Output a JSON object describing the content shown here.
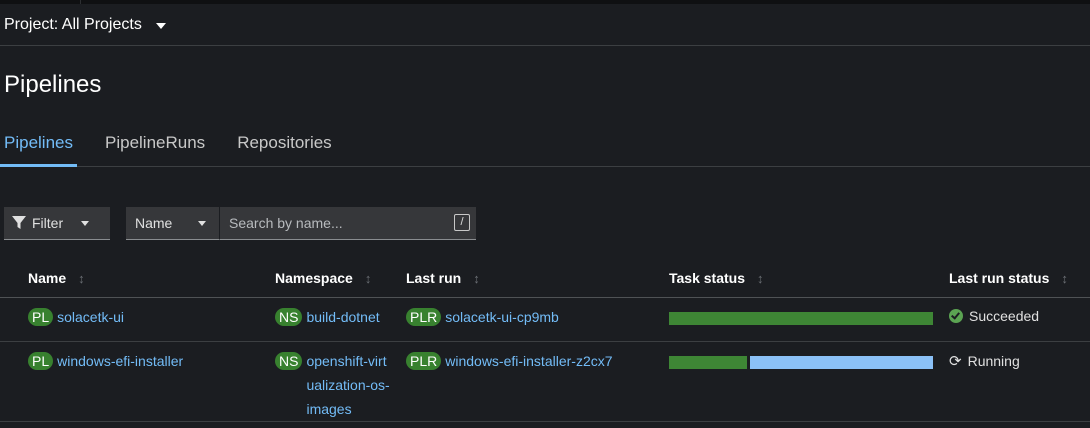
{
  "project": {
    "label": "Project: All Projects"
  },
  "page": {
    "title": "Pipelines"
  },
  "tabs": [
    {
      "label": "Pipelines",
      "active": true
    },
    {
      "label": "PipelineRuns",
      "active": false
    },
    {
      "label": "Repositories",
      "active": false
    }
  ],
  "toolbar": {
    "filter_label": "Filter",
    "name_select": "Name",
    "search_placeholder": "Search by name...",
    "search_shortcut": "/"
  },
  "table": {
    "columns": [
      "Name",
      "Namespace",
      "Last run",
      "Task status",
      "Last run status"
    ],
    "rows": [
      {
        "name_badge": "PL",
        "name": "solacetk-ui",
        "ns_badge": "NS",
        "namespace": "build-dotnet",
        "run_badge": "PLR",
        "last_run": "solacetk-ui-cp9mb",
        "task_status": {
          "succeeded_fraction": 1.0,
          "running_fraction": 0.0
        },
        "status": "Succeeded",
        "status_icon": "check-circle-icon"
      },
      {
        "name_badge": "PL",
        "name": "windows-efi-installer",
        "ns_badge": "NS",
        "namespace": "openshift-virtualization-os-images",
        "run_badge": "PLR",
        "last_run": "windows-efi-installer-z2cx7",
        "task_status": {
          "succeeded_fraction": 0.3,
          "running_fraction": 0.7
        },
        "status": "Running",
        "status_icon": "sync-icon"
      }
    ]
  },
  "colors": {
    "background": "#1b1d21",
    "accent": "#73bcf7",
    "success": "#3e8635",
    "running": "#8bc1f7",
    "badge": "#38812f"
  }
}
